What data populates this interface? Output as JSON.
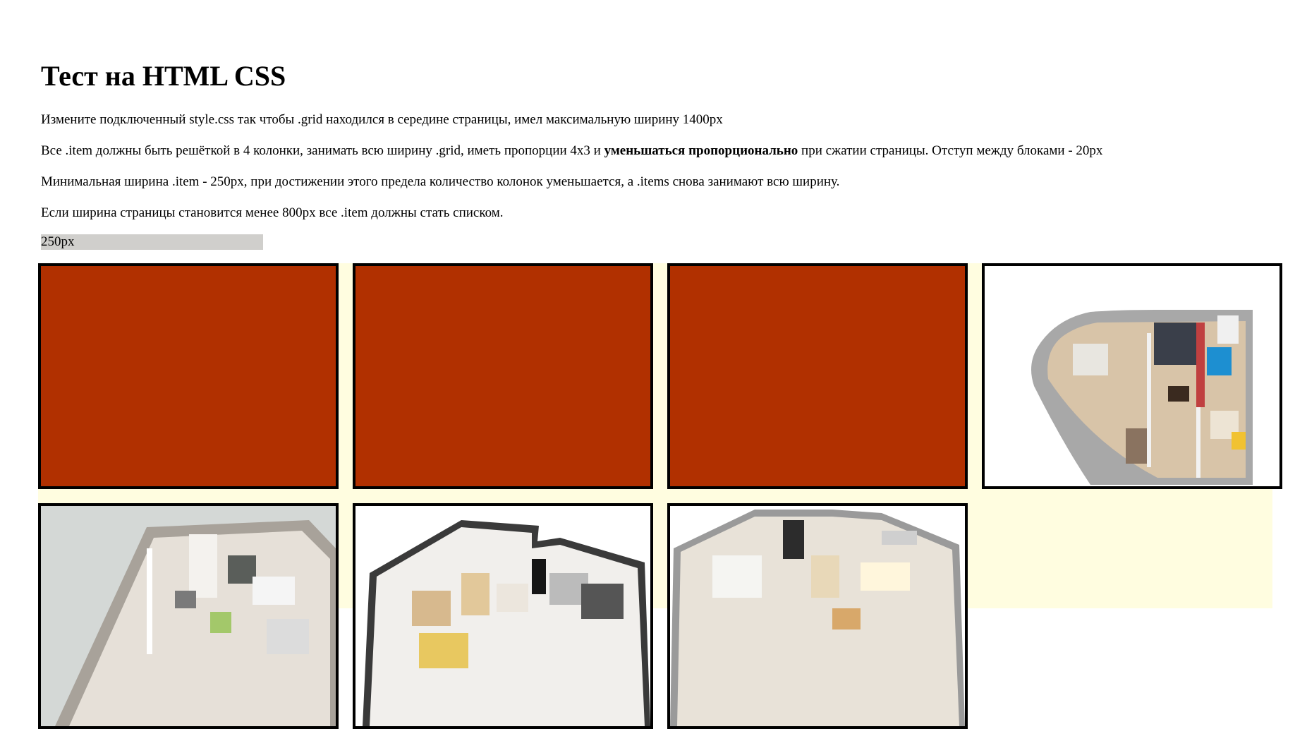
{
  "page": {
    "title": "Тест на HTML CSS",
    "task_1": "Измените подключенный style.css так чтобы .grid находился в середине страницы, имел максимальную ширину 1400px",
    "task_2_pre": "Все .item должны быть решёткой в 4 колонки, занимать всю ширину .grid, иметь пропорции 4x3 и ",
    "task_2_bold": "уменьшаться пропорционально",
    "task_2_post": " при сжатии страницы. Отступ между блоками - 20px",
    "task_3": "Минимальная ширина .item - 250px, при достижении этого предела количество колонок уменьшается, а .items снова занимают всю ширину.",
    "task_4": "Если ширина страницы становится менее 800px все .item должны стать списком.",
    "ruler_label": "250px"
  },
  "colors": {
    "item_fill": "#b13000",
    "grid_bg": "#fffde0",
    "ruler_bg": "#d0cfcc"
  },
  "grid": {
    "items": [
      {
        "type": "solid"
      },
      {
        "type": "solid"
      },
      {
        "type": "solid"
      },
      {
        "type": "floorplan-image"
      },
      {
        "type": "floorplan-image"
      },
      {
        "type": "floorplan-image"
      },
      {
        "type": "floorplan-image"
      }
    ]
  }
}
